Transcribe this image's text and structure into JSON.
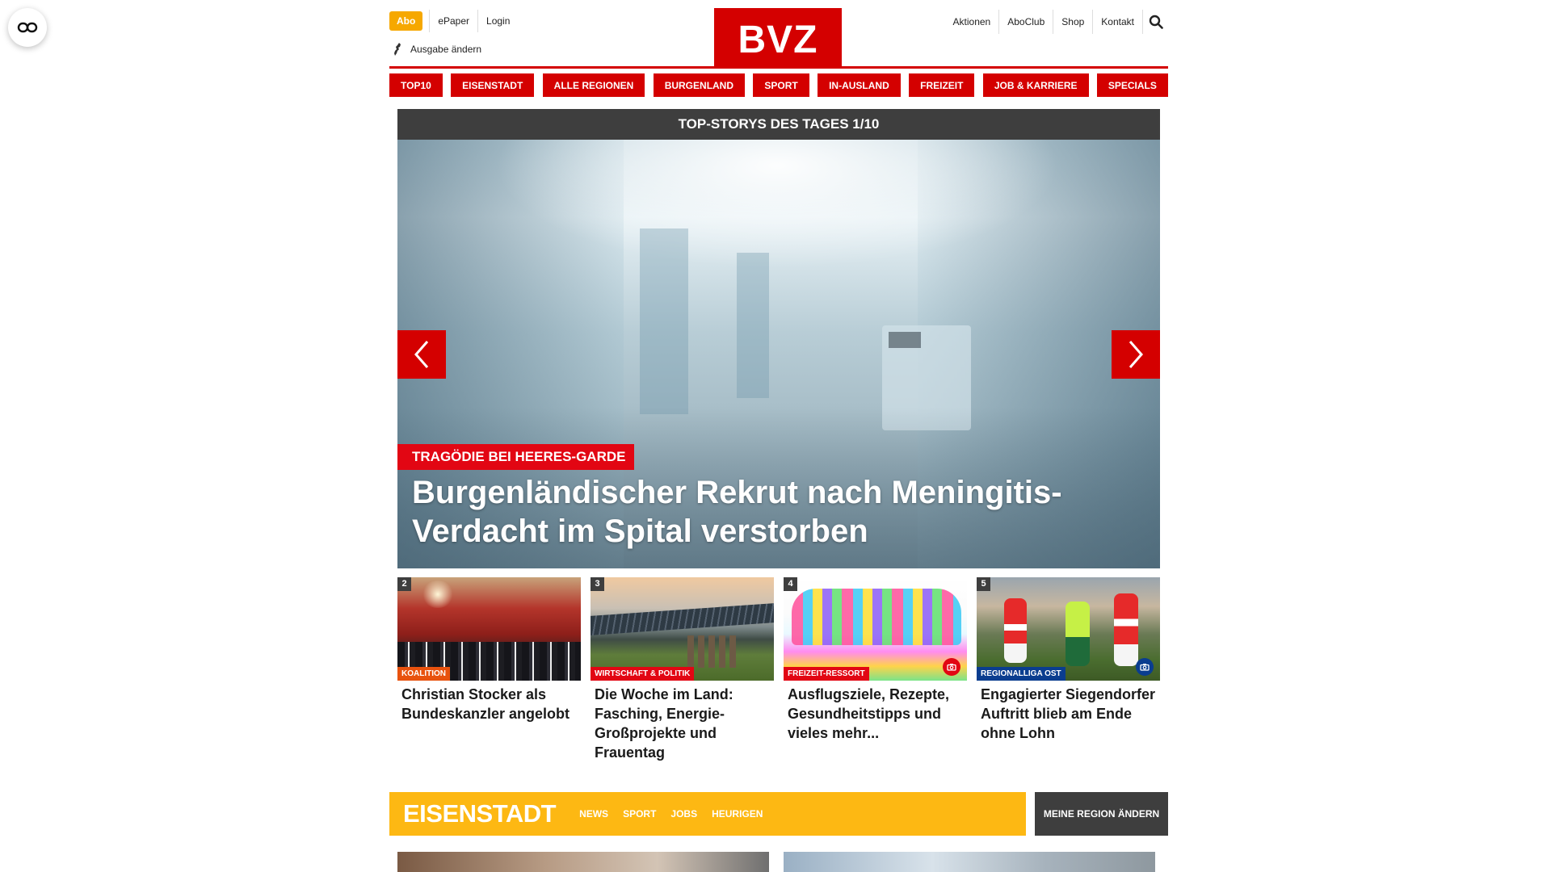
{
  "header": {
    "abo_label": "Abo",
    "epaper_label": "ePaper",
    "login_label": "Login",
    "edition_label": "Ausgabe ändern",
    "logo_text": "BVZ",
    "right_links": [
      "Aktionen",
      "AboClub",
      "Shop",
      "Kontakt"
    ]
  },
  "nav": {
    "items": [
      "TOP10",
      "EISENSTADT",
      "ALLE REGIONEN",
      "BURGENLAND",
      "SPORT",
      "IN-AUSLAND",
      "FREIZEIT",
      "JOB & KARRIERE",
      "SPECIALS"
    ]
  },
  "hero": {
    "bar_title": "TOP-STORYS DES TAGES 1/10",
    "kicker": "TRAGÖDIE BEI HEERES-GARDE",
    "title": "Burgenländischer Rekrut nach Meningitis-Verdacht im Spital verstorben"
  },
  "teasers": [
    {
      "num": "2",
      "kicker": "KOALITION",
      "kicker_color": "#e8520e",
      "title": "Christian Stocker als Bundeskanzler angelobt",
      "camera": false
    },
    {
      "num": "3",
      "kicker": "WIRTSCHAFT & POLITIK",
      "kicker_color": "#e20613",
      "title": "Die Woche im Land: Fasching, Energie-Großprojekte und Frauentag",
      "camera": false
    },
    {
      "num": "4",
      "kicker": "FREIZEIT-RESSORT",
      "kicker_color": "#e20613",
      "title": "Ausflugsziele, Rezepte, Gesundheitstipps und vieles mehr...",
      "camera": true,
      "camera_color": "#e20613"
    },
    {
      "num": "5",
      "kicker": "REGIONALLIGA OST",
      "kicker_color": "#0a3d8f",
      "title": "Engagierter Siegendorfer Auftritt blieb am Ende ohne Lohn",
      "camera": true,
      "camera_color": "#0a3d8f"
    }
  ],
  "region": {
    "title": "EISENSTADT",
    "links": [
      "NEWS",
      "SPORT",
      "JOBS",
      "HEURIGEN"
    ],
    "change_label": "MEINE REGION ÄNDERN"
  },
  "colors": {
    "brand_red": "#d40000",
    "region_yellow": "#fdb813",
    "abo_orange": "#f6a800",
    "dark_bar": "#3e3e3e"
  }
}
